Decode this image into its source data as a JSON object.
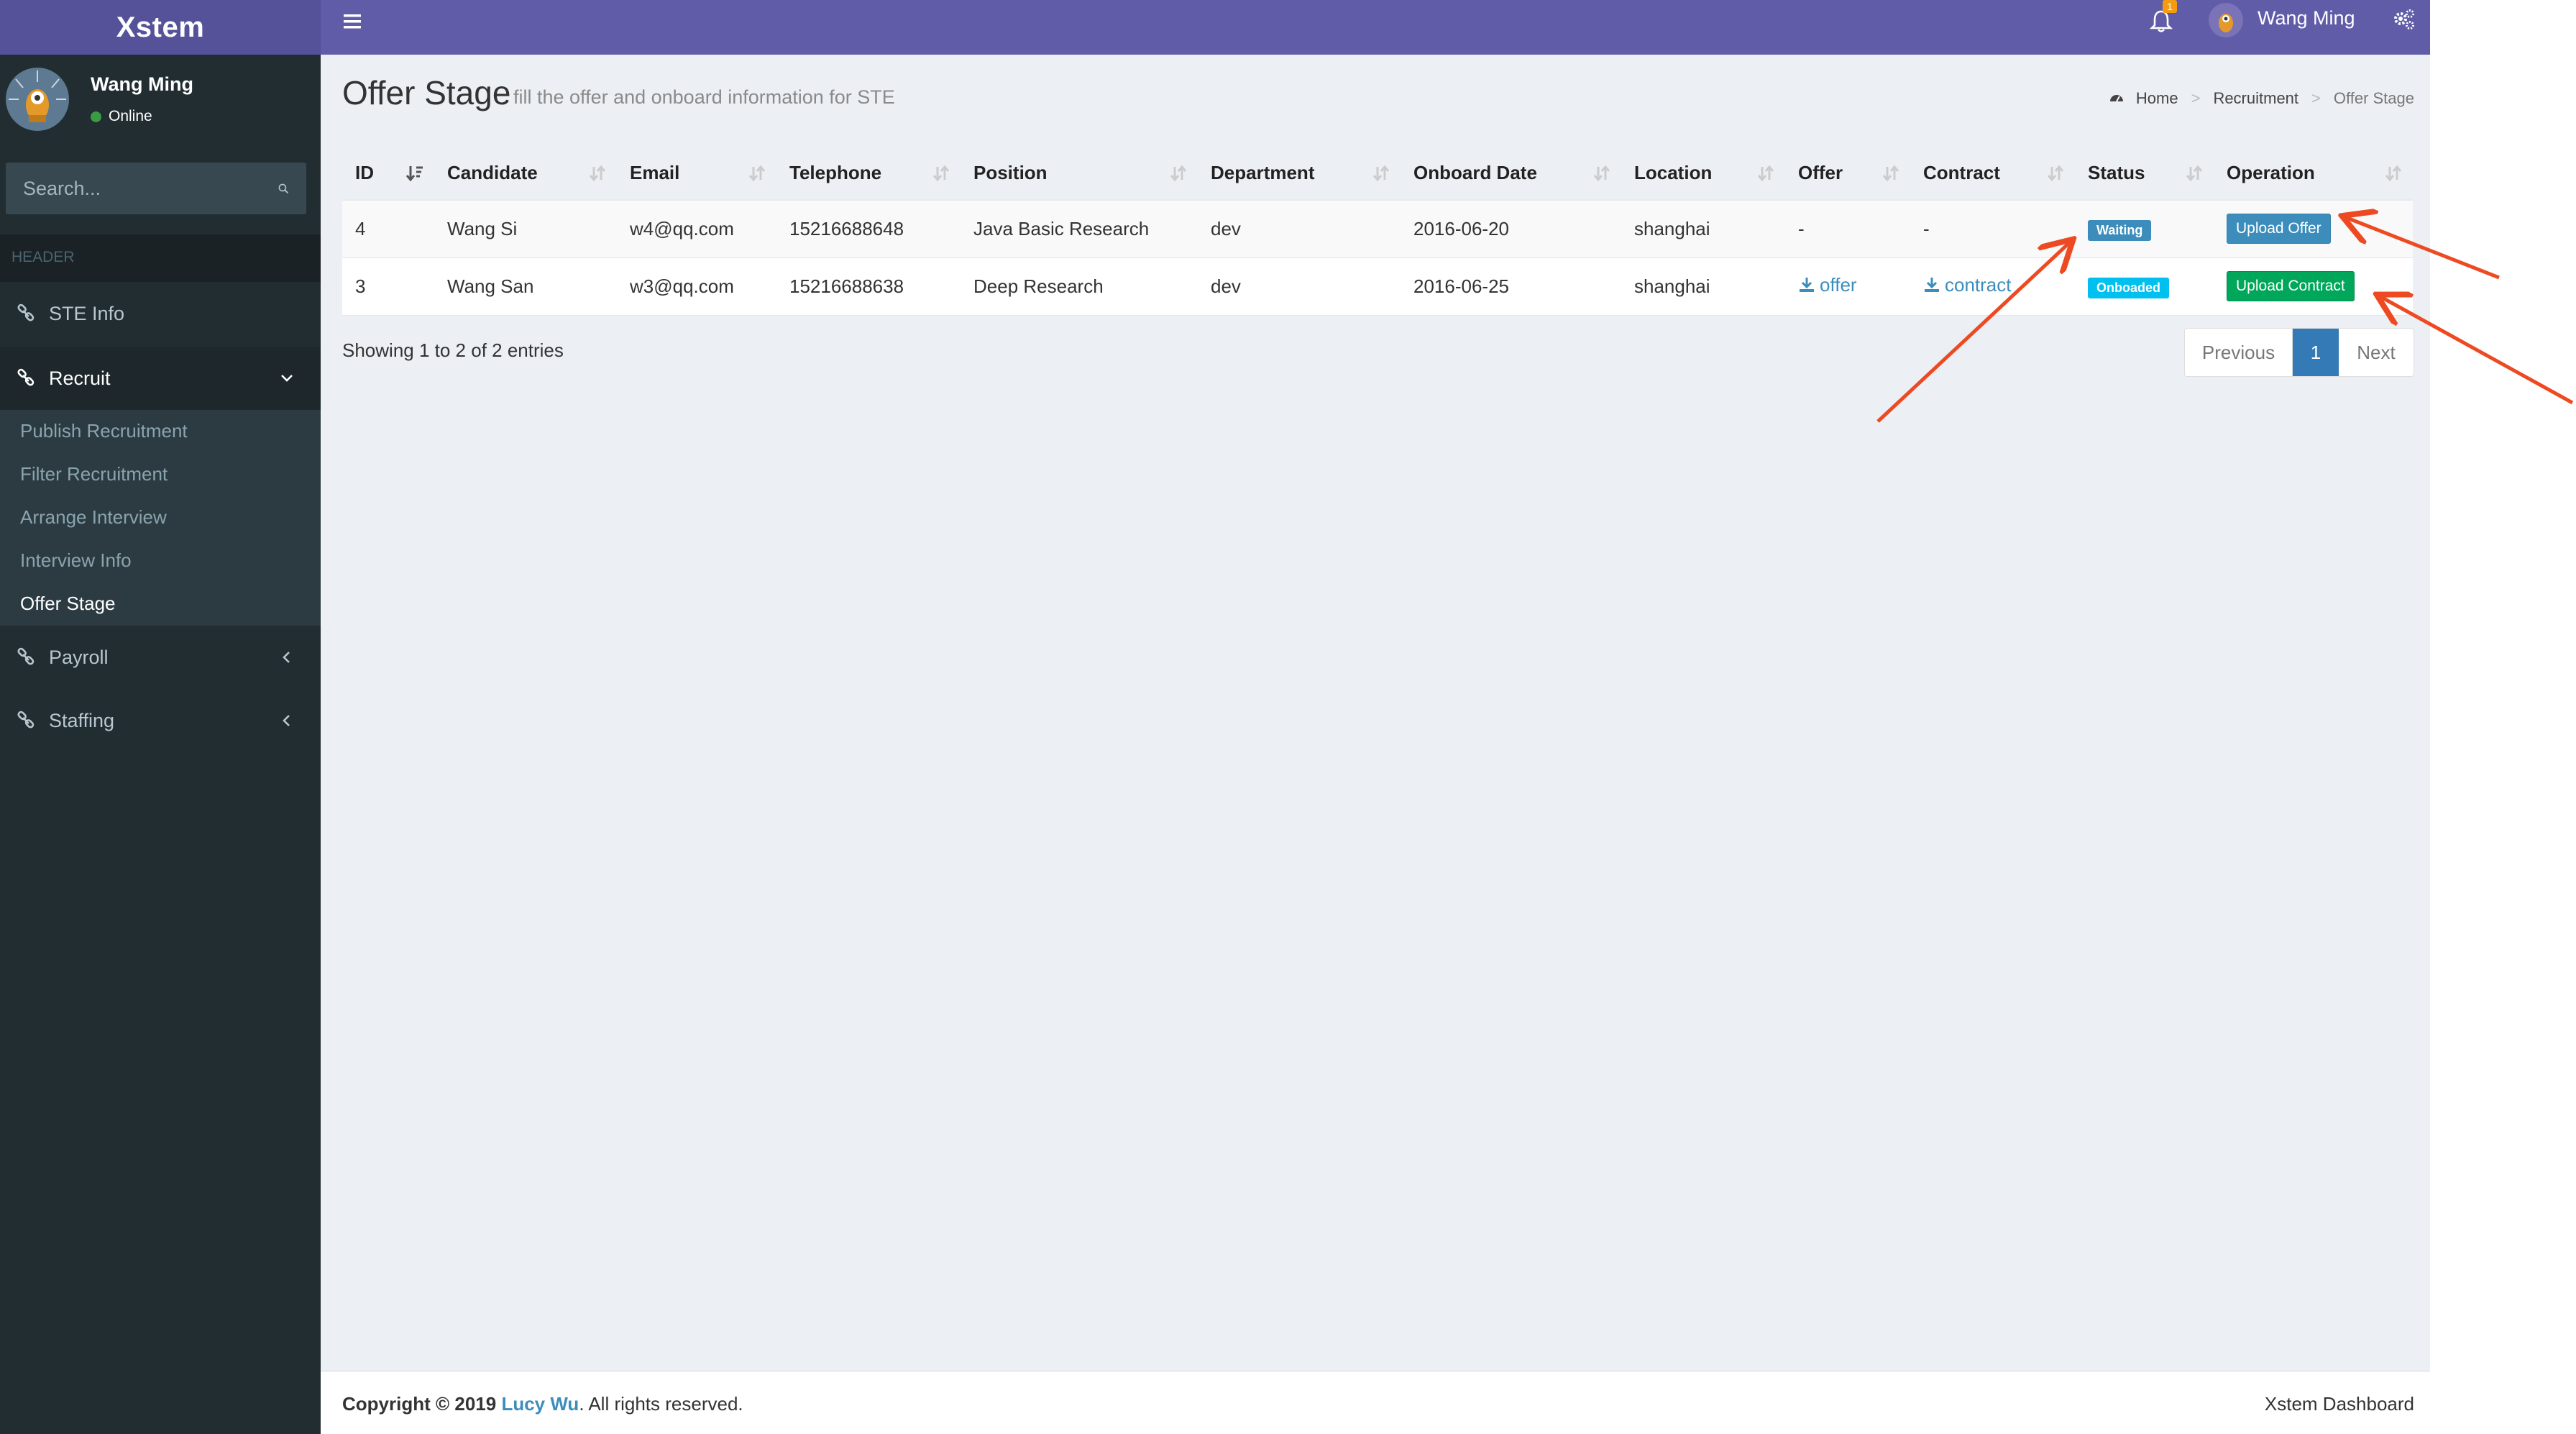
{
  "app": {
    "logo": "Xstem"
  },
  "user": {
    "name": "Wang Ming",
    "status": "Online"
  },
  "sidebar": {
    "search_placeholder": "Search...",
    "header": "HEADER",
    "items": [
      {
        "label": "STE Info"
      },
      {
        "label": "Recruit"
      },
      {
        "label": "Payroll"
      },
      {
        "label": "Staffing"
      }
    ],
    "recruit_submenu": [
      {
        "label": "Publish Recruitment"
      },
      {
        "label": "Filter Recruitment"
      },
      {
        "label": "Arrange Interview"
      },
      {
        "label": "Interview Info"
      },
      {
        "label": "Offer Stage"
      }
    ]
  },
  "topbar": {
    "notification_count": "1",
    "user_name": "Wang Ming"
  },
  "page": {
    "title": "Offer Stage",
    "subtitle": "fill the offer and onboard information for STE",
    "breadcrumb": [
      "Home",
      "Recruitment",
      "Offer Stage"
    ]
  },
  "table": {
    "columns": [
      "ID",
      "Candidate",
      "Email",
      "Telephone",
      "Position",
      "Department",
      "Onboard Date",
      "Location",
      "Offer",
      "Contract",
      "Status",
      "Operation"
    ],
    "rows": [
      {
        "id": "4",
        "candidate": "Wang Si",
        "email": "w4@qq.com",
        "telephone": "15216688648",
        "position": "Java Basic Research",
        "department": "dev",
        "onboard_date": "2016-06-20",
        "location": "shanghai",
        "offer": "-",
        "contract": "-",
        "status": "Waiting",
        "operation": "Upload Offer"
      },
      {
        "id": "3",
        "candidate": "Wang San",
        "email": "w3@qq.com",
        "telephone": "15216688638",
        "position": "Deep Research",
        "department": "dev",
        "onboard_date": "2016-06-25",
        "location": "shanghai",
        "offer": "offer",
        "contract": "contract",
        "status": "Onboaded",
        "operation": "Upload Contract"
      }
    ],
    "entries_info": "Showing 1 to 2 of 2 entries"
  },
  "pagination": {
    "previous": "Previous",
    "current": "1",
    "next": "Next"
  },
  "footer": {
    "copyright": "Copyright © 2019",
    "author": "Lucy Wu",
    "rights": ". All rights reserved.",
    "right_text": "Xstem Dashboard"
  },
  "colors": {
    "topbar": "#605ca8",
    "logo_bg": "#555299",
    "sidebar": "#222d32",
    "accent_blue": "#3c8dbc",
    "success_green": "#00a65a",
    "info_cyan": "#00c0ef",
    "annotation_arrow": "#ee4a22"
  }
}
